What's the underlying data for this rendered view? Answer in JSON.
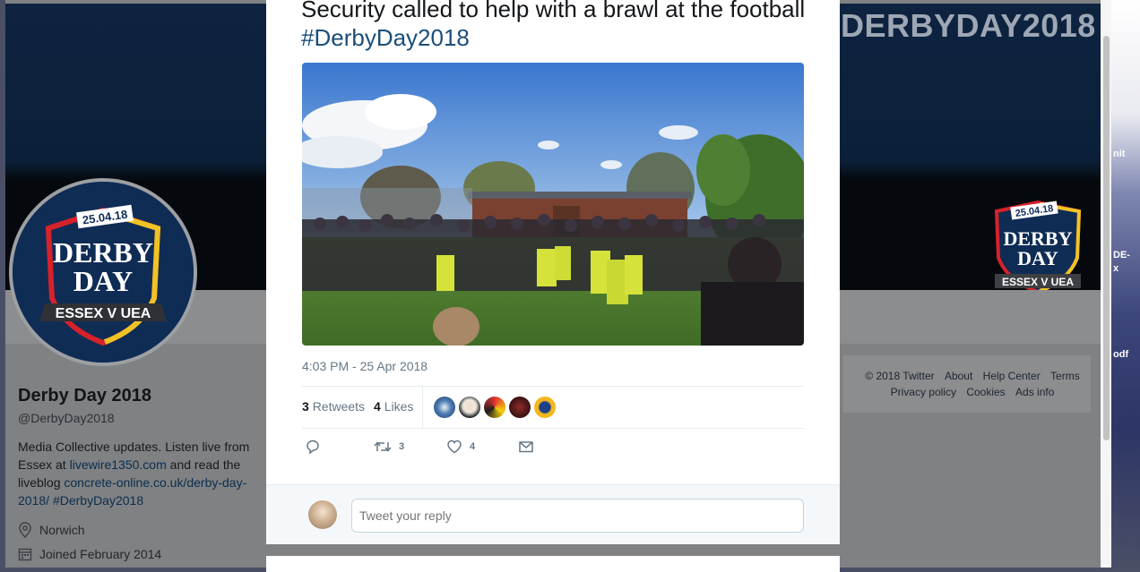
{
  "background_page": {
    "banner_title": "DERBYDAY2018",
    "crest": {
      "date": "25.04.18",
      "line1": "DERBY",
      "line2": "DAY",
      "ribbon": "ESSEX V UEA"
    },
    "profile": {
      "name": "Derby Day 2018",
      "handle": "@DerbyDay2018",
      "bio_parts": {
        "p1": "Media Collective updates. Listen live from Essex at ",
        "link1": "livewire1350.com",
        "p2": " and read the liveblog ",
        "link2": "concrete-online.co.uk/derby-day-2018/",
        "p3": " ",
        "link3": "#DerbyDay2018"
      },
      "location": "Norwich",
      "joined": "Joined February 2014"
    },
    "footer_links": [
      "© 2018 Twitter",
      "About",
      "Help Center",
      "Terms",
      "Privacy policy",
      "Cookies",
      "Ads info"
    ]
  },
  "desktop": {
    "labels": [
      "nit",
      "DE-",
      "x",
      "odf"
    ]
  },
  "tweet": {
    "text": "Security called to help with a brawl at the football ",
    "hashtag": "#DerbyDay2018",
    "timestamp": "4:03 PM - 25 Apr 2018",
    "retweets_count": "3",
    "retweets_label": "Retweets",
    "likes_count": "4",
    "likes_label": "Likes",
    "likers": [
      "liker-1",
      "liker-2",
      "liker-3",
      "liker-4",
      "liker-5"
    ],
    "actions": {
      "reply_icon": "reply-icon",
      "retweet_icon": "retweet-icon",
      "retweet_count": "3",
      "like_icon": "heart-icon",
      "like_count": "4",
      "dm_icon": "envelope-icon"
    },
    "reply_placeholder": "Tweet your reply"
  }
}
